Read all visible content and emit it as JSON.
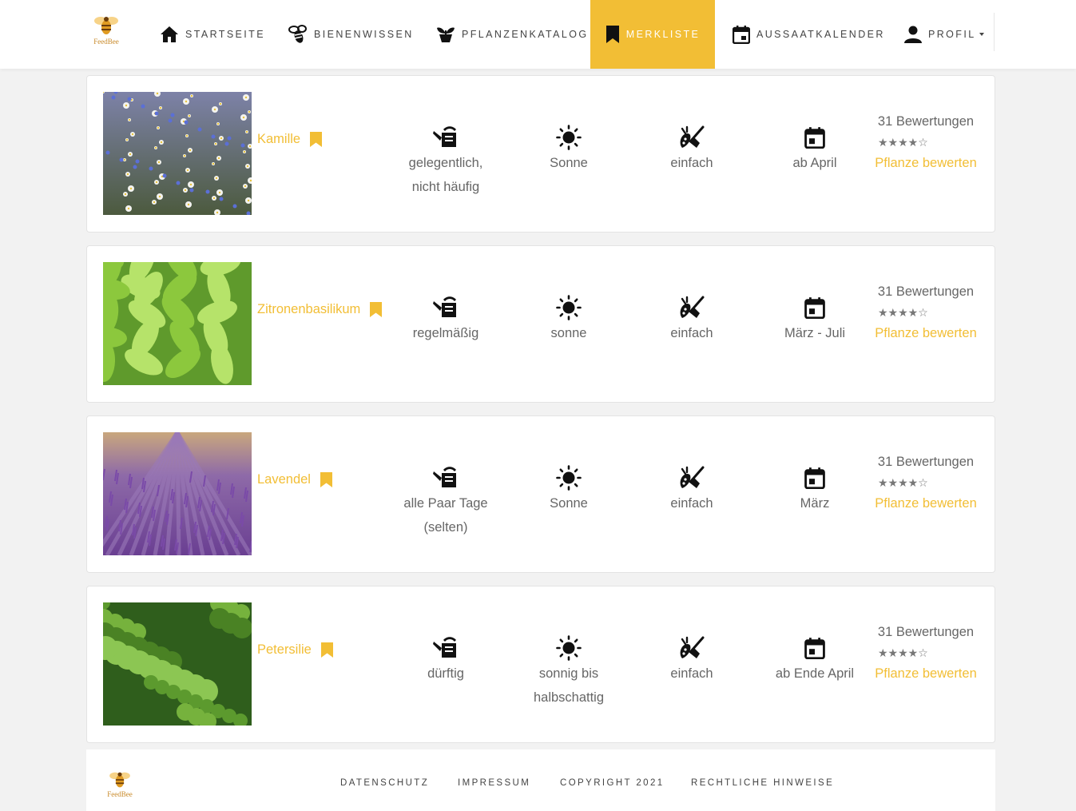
{
  "brand": {
    "logo_text": "FeedBee"
  },
  "nav": {
    "items": [
      {
        "label": "Startseite",
        "icon": "home-icon"
      },
      {
        "label": "Bienenwissen",
        "icon": "bee-icon"
      },
      {
        "label": "Pflanzenkatalog",
        "icon": "plant-pot-icon"
      },
      {
        "label": "Merkliste",
        "icon": "bookmark-icon",
        "active": true
      },
      {
        "label": "Aussaatkalender",
        "icon": "calendar-icon"
      },
      {
        "label": "Profil",
        "icon": "person-icon",
        "dropdown": true
      }
    ]
  },
  "plants": [
    {
      "name": "Kamille",
      "water": [
        "gelegentlich,",
        "nicht häufig"
      ],
      "sun": [
        "Sonne"
      ],
      "care": [
        "einfach"
      ],
      "sowing": [
        "ab April"
      ],
      "ratings": "31 Bewertungen",
      "stars": "★★★★☆",
      "stars_value": 4,
      "rate_label": "Pflanze bewerten"
    },
    {
      "name": "Zitronenbasilikum",
      "water": [
        "regelmäßig"
      ],
      "sun": [
        "sonne"
      ],
      "care": [
        "einfach"
      ],
      "sowing": [
        "März - Juli"
      ],
      "ratings": "31 Bewertungen",
      "stars": "★★★★☆",
      "stars_value": 4,
      "rate_label": "Pflanze bewerten"
    },
    {
      "name": "Lavendel",
      "water": [
        "alle Paar Tage",
        "(selten)"
      ],
      "sun": [
        "Sonne"
      ],
      "care": [
        "einfach"
      ],
      "sowing": [
        "März"
      ],
      "ratings": "31 Bewertungen",
      "stars": "★★★★☆",
      "stars_value": 4,
      "rate_label": "Pflanze bewerten"
    },
    {
      "name": "Petersilie",
      "water": [
        "dürftig"
      ],
      "sun": [
        "sonnig bis",
        "halbschattig"
      ],
      "care": [
        "einfach"
      ],
      "sowing": [
        "ab Ende April"
      ],
      "ratings": "31 Bewertungen",
      "stars": "★★★★☆",
      "stars_value": 4,
      "rate_label": "Pflanze bewerten"
    }
  ],
  "footer": {
    "logo_text": "FeedBee",
    "links": [
      "Datenschutz",
      "Impressum",
      "Copyright 2021",
      "Rechtliche Hinweise"
    ]
  },
  "colors": {
    "accent": "#f2be35",
    "background": "#f2f2f2",
    "text": "#666666"
  }
}
